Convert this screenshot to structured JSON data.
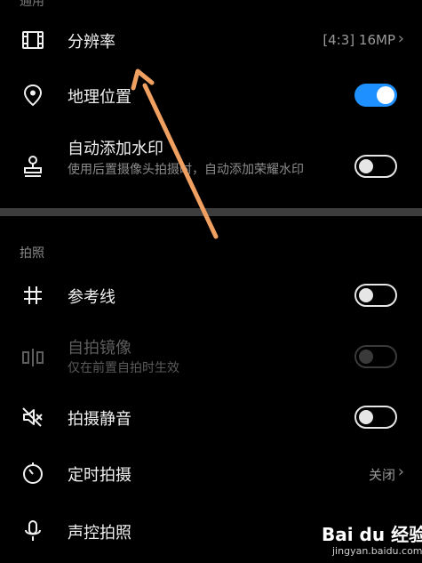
{
  "sections": {
    "general_cut": "通用",
    "photo": "拍照"
  },
  "rows": {
    "resolution": {
      "title": "分辨率",
      "value": "[4:3] 16MP",
      "icon": "film-frame-icon"
    },
    "location": {
      "title": "地理位置",
      "toggle": true,
      "icon": "location-pin-icon"
    },
    "watermark": {
      "title": "自动添加水印",
      "subtitle": "使用后置摄像头拍摄时，自动添加荣耀水印",
      "toggle": false,
      "icon": "stamp-icon"
    },
    "grid": {
      "title": "参考线",
      "toggle": false,
      "icon": "grid-icon"
    },
    "mirror": {
      "title": "自拍镜像",
      "subtitle": "仅在前置自拍时生效",
      "toggle": false,
      "disabled": true,
      "icon": "mirror-icon"
    },
    "mute": {
      "title": "拍摄静音",
      "toggle": false,
      "icon": "mute-speaker-icon"
    },
    "timer": {
      "title": "定时拍摄",
      "value": "关闭",
      "icon": "timer-icon"
    },
    "voice": {
      "title": "声控拍照",
      "icon": "microphone-icon"
    }
  },
  "watermark_overlay": {
    "brand": "Bai du 经验",
    "url": "jingyan.baidu.com"
  },
  "colors": {
    "background": "#000000",
    "accent": "#1e90ff",
    "annotation_arrow": "#f0a060"
  }
}
